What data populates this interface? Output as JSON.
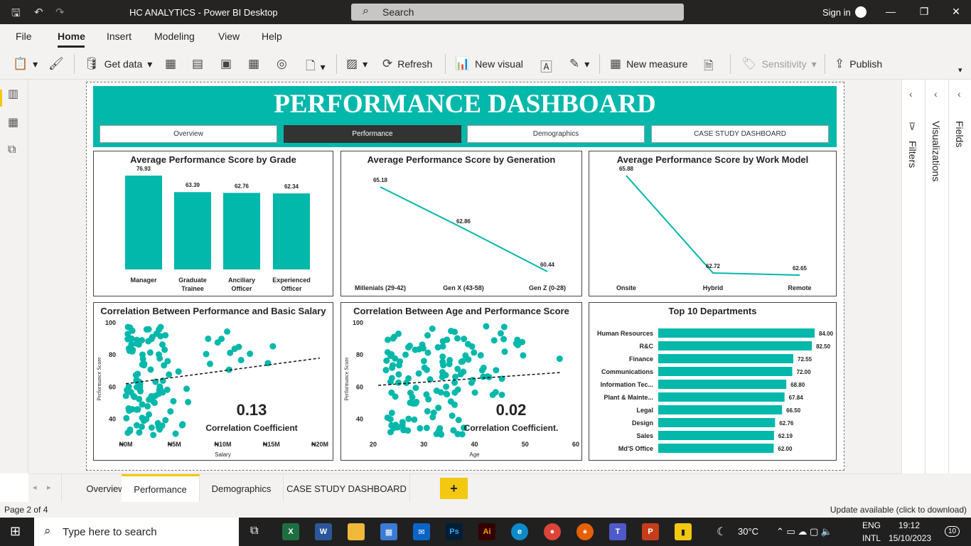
{
  "window": {
    "title": "HC ANALYTICS - Power BI Desktop",
    "search_placeholder": "Search",
    "signin": "Sign in"
  },
  "menu": [
    "File",
    "Home",
    "Insert",
    "Modeling",
    "View",
    "Help"
  ],
  "ribbon": {
    "get_data": "Get data",
    "refresh": "Refresh",
    "new_visual": "New visual",
    "new_measure": "New measure",
    "sensitivity": "Sensitivity",
    "publish": "Publish"
  },
  "dashboard": {
    "title": "PERFORMANCE DASHBOARD",
    "nav": [
      "Overview",
      "Performance",
      "Demographics",
      "CASE STUDY DASHBOARD"
    ]
  },
  "charts": {
    "grade": {
      "title": "Average Performance Score by Grade"
    },
    "generation": {
      "title": "Average Performance Score by Generation"
    },
    "workmodel": {
      "title": "Average Performance Score by Work Model"
    },
    "salary": {
      "title": "Correlation Between Performance and Basic Salary",
      "coef": "0.13",
      "coef_label": "Correlation Coefficient"
    },
    "age": {
      "title": "Correlation Between Age and Performance Score",
      "coef": "0.02",
      "coef_label": "Correlation Coefficient."
    },
    "depts": {
      "title": "Top 10 Departments"
    }
  },
  "chart_data": [
    {
      "type": "bar",
      "title": "Average Performance Score by Grade",
      "categories": [
        "Manager",
        "Graduate Trainee",
        "Anciliary Officer",
        "Experienced Officer"
      ],
      "values": [
        76.93,
        63.39,
        62.76,
        62.34
      ],
      "labels": [
        "76.93",
        "63.39",
        "62.76",
        "62.34"
      ]
    },
    {
      "type": "line",
      "title": "Average Performance Score by Generation",
      "categories": [
        "Millenials (29-42)",
        "Gen X (43-58)",
        "Gen Z (0-28)"
      ],
      "values": [
        65.18,
        62.86,
        60.44
      ],
      "labels": [
        "65.18",
        "62.86",
        "60.44"
      ]
    },
    {
      "type": "line",
      "title": "Average Performance Score by Work Model",
      "categories": [
        "Onsite",
        "Hybrid",
        "Remote"
      ],
      "values": [
        65.88,
        62.72,
        62.65
      ],
      "labels": [
        "65.88",
        "62.72",
        "62.65"
      ]
    },
    {
      "type": "scatter",
      "title": "Correlation Between Performance and Basic Salary",
      "xlabel": "Salary",
      "ylabel": "Performance Score",
      "xticks": [
        "₦0M",
        "₦5M",
        "₦10M",
        "₦15M",
        "₦20M"
      ],
      "xlim": [
        0,
        20
      ],
      "ylim": [
        30,
        100
      ],
      "yticks": [
        "100",
        "80",
        "60",
        "40"
      ],
      "trend": {
        "x": [
          0,
          20
        ],
        "y": [
          62,
          78
        ]
      },
      "correlation": 0.13
    },
    {
      "type": "scatter",
      "title": "Correlation Between Age and Performance Score",
      "xlabel": "Age",
      "ylabel": "Performance Score",
      "xticks": [
        "20",
        "30",
        "40",
        "50",
        "60"
      ],
      "xlim": [
        20,
        60
      ],
      "ylim": [
        30,
        100
      ],
      "yticks": [
        "100",
        "80",
        "60",
        "40"
      ],
      "trend": {
        "x": [
          21,
          57
        ],
        "y": [
          61,
          69
        ]
      },
      "correlation": 0.02
    },
    {
      "type": "bar",
      "orientation": "horizontal",
      "title": "Top 10 Departments",
      "categories": [
        "Human Resources",
        "R&C",
        "Finance",
        "Communications",
        "Information Tec...",
        "Plant & Mainte...",
        "Legal",
        "Design",
        "Sales",
        "Md'S Office"
      ],
      "values": [
        84.0,
        82.5,
        72.55,
        72.0,
        68.8,
        67.84,
        66.5,
        62.76,
        62.19,
        62.0
      ],
      "labels": [
        "84.00",
        "82.50",
        "72.55",
        "72.00",
        "68.80",
        "67.84",
        "66.50",
        "62.76",
        "62.19",
        "62.00"
      ]
    }
  ],
  "colors": {
    "accent": "#01b8aa",
    "yellow": "#f2c811",
    "dark": "#252423"
  },
  "panes": {
    "filters": "Filters",
    "visualizations": "Visualizations",
    "fields": "Fields"
  },
  "pages": [
    "Overview",
    "Performance",
    "Demographics",
    "CASE STUDY DASHBOARD"
  ],
  "add_page": "+",
  "status": {
    "page": "Page 2 of 4",
    "update": "Update available (click to download)"
  },
  "taskbar": {
    "search": "Type here to search",
    "weather": "30°C",
    "lang1": "ENG",
    "lang2": "INTL",
    "time": "19:12",
    "date": "15/10/2023",
    "notif": "10"
  }
}
